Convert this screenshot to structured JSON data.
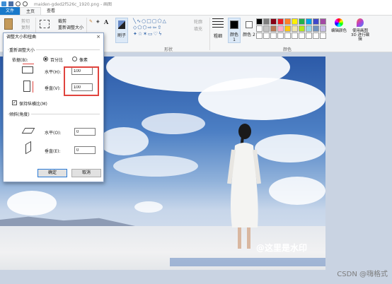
{
  "window": {
    "title": "maiden-gded2f526c_1920.png - 画图"
  },
  "tabs": [
    {
      "label": "文件"
    },
    {
      "label": "主页"
    },
    {
      "label": "查看"
    }
  ],
  "ribbon": {
    "paste_label": "粘贴",
    "cut_label": "剪切",
    "copy_label": "复制",
    "crop_label": "裁剪",
    "resize_label": "重新调整大小",
    "brush_label": "刷子",
    "shapes_label": "形状",
    "outline_label": "轮廓",
    "fill_label": "填充",
    "size_label": "粗细",
    "color1_label": "颜色 1",
    "color2_label": "颜色 2",
    "colors_group": "颜色",
    "edit_colors_label": "编辑颜色",
    "paint3d_label": "使用画图 3D 进行编辑",
    "palette": [
      "#000000",
      "#7f7f7f",
      "#880015",
      "#ed1c24",
      "#ff7f27",
      "#fff200",
      "#22b14c",
      "#00a2e8",
      "#3f48cc",
      "#a349a4",
      "#ffffff",
      "#c3c3c3",
      "#b97a57",
      "#ffaec9",
      "#ffc90e",
      "#efe4b0",
      "#b5e61d",
      "#99d9ea",
      "#7092be",
      "#c8bfe7",
      "#ffffff",
      "#ffffff",
      "#ffffff",
      "#ffffff",
      "#ffffff",
      "#ffffff",
      "#ffffff",
      "#ffffff",
      "#ffffff",
      "#ffffff"
    ]
  },
  "dialog": {
    "title": "调整大小和扭曲",
    "close": "×",
    "resize_section": "重新调整大小",
    "by_label": "依据(B):",
    "percent_label": "百分比",
    "pixels_label": "像素",
    "horizontal_label": "水平(H):",
    "horizontal_value": "100",
    "vertical_label": "垂直(V):",
    "vertical_value": "100",
    "keep_ratio_label": "保持纵横比(M)",
    "skew_section": "倾斜(角度)",
    "skew_h_label": "水平(O):",
    "skew_h_value": "0",
    "skew_v_label": "垂直(E):",
    "skew_v_value": "0",
    "ok_label": "确定",
    "cancel_label": "取消"
  },
  "image": {
    "watermark": "@这里是水印"
  },
  "footer": {
    "csdn": "CSDN @嗨格式"
  }
}
